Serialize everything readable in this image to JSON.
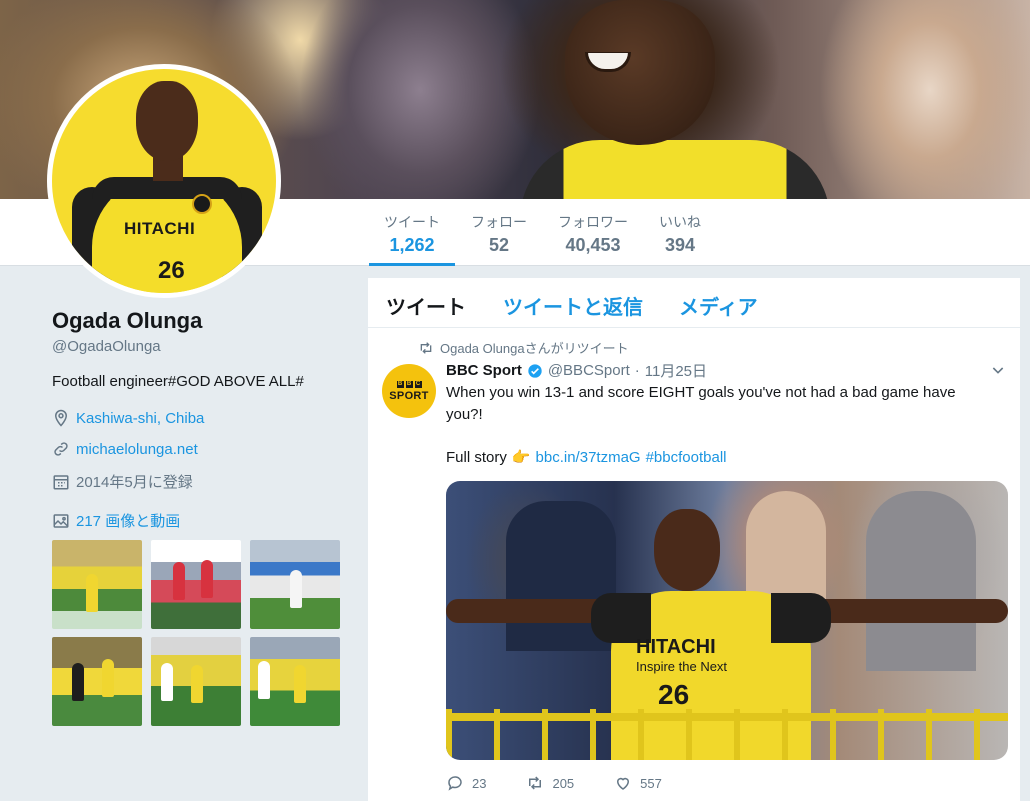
{
  "profile": {
    "name": "Ogada Olunga",
    "handle": "@OgadaOlunga",
    "bio": "Football engineer#GOD ABOVE ALL#",
    "location": "Kashiwa-shi, Chiba",
    "website": "michaelolunga.net",
    "joined": "2014年5月に登録",
    "media_link": "217 画像と動画",
    "avatar_jersey_text": "HITACHI",
    "avatar_number": "26"
  },
  "nav": {
    "stats": [
      {
        "label": "ツイート",
        "value": "1,262"
      },
      {
        "label": "フォロー",
        "value": "52"
      },
      {
        "label": "フォロワー",
        "value": "40,453"
      },
      {
        "label": "いいね",
        "value": "394"
      }
    ]
  },
  "timeline": {
    "tabs": [
      "ツイート",
      "ツイートと返信",
      "メディア"
    ],
    "tweet": {
      "retweet_context": "Ogada Olungaさんがリツイート",
      "author": "BBC Sport",
      "handle": "@BBCSport",
      "dot": "·",
      "date": "11月25日",
      "avatar_letters": [
        "B",
        "B",
        "C"
      ],
      "avatar_word": "SPORT",
      "text": "When you win 13-1 and score EIGHT goals you've not had a bad game have you?!",
      "story_prefix": "Full story",
      "story_emoji": "👉",
      "story_link": "bbc.in/37tzmaG",
      "story_hashtag": "#bbcfootball",
      "photo_jersey_text": "HITACHI",
      "photo_jersey_sub": "Inspire the Next",
      "photo_number": "26",
      "replies": "23",
      "retweets": "205",
      "likes": "557"
    }
  },
  "colors": {
    "accent": "#1b95e0",
    "background": "#e6ecf0",
    "text_muted": "#657786",
    "jersey_yellow": "#f2df2a"
  },
  "icons": {
    "location": "map-pin-icon",
    "website": "link-icon",
    "joined": "calendar-icon",
    "media": "image-icon",
    "retweet_context": "retweet-icon",
    "verified": "verified-badge-icon",
    "caret": "chevron-down-icon",
    "reply": "reply-icon",
    "retweet": "retweet-icon",
    "like": "heart-icon"
  }
}
